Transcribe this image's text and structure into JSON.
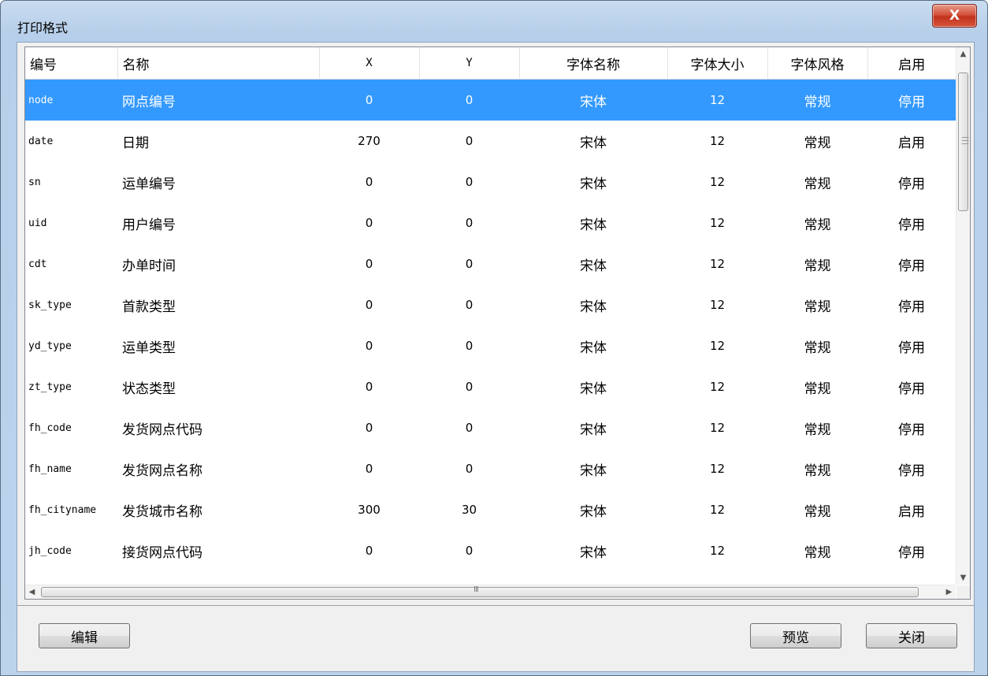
{
  "window": {
    "title": "打印格式",
    "close_label": "X"
  },
  "table": {
    "columns": [
      "编号",
      "名称",
      "X",
      "Y",
      "字体名称",
      "字体大小",
      "字体风格",
      "启用"
    ],
    "rows": [
      {
        "code": "node",
        "name": "网点编号",
        "x": "0",
        "y": "0",
        "font": "宋体",
        "size": "12",
        "style": "常规",
        "enabled": "停用",
        "selected": true
      },
      {
        "code": "date",
        "name": "日期",
        "x": "270",
        "y": "0",
        "font": "宋体",
        "size": "12",
        "style": "常规",
        "enabled": "启用"
      },
      {
        "code": "sn",
        "name": "运单编号",
        "x": "0",
        "y": "0",
        "font": "宋体",
        "size": "12",
        "style": "常规",
        "enabled": "停用"
      },
      {
        "code": "uid",
        "name": "用户编号",
        "x": "0",
        "y": "0",
        "font": "宋体",
        "size": "12",
        "style": "常规",
        "enabled": "停用"
      },
      {
        "code": "cdt",
        "name": "办单时间",
        "x": "0",
        "y": "0",
        "font": "宋体",
        "size": "12",
        "style": "常规",
        "enabled": "停用"
      },
      {
        "code": "sk_type",
        "name": "首款类型",
        "x": "0",
        "y": "0",
        "font": "宋体",
        "size": "12",
        "style": "常规",
        "enabled": "停用"
      },
      {
        "code": "yd_type",
        "name": "运单类型",
        "x": "0",
        "y": "0",
        "font": "宋体",
        "size": "12",
        "style": "常规",
        "enabled": "停用"
      },
      {
        "code": "zt_type",
        "name": "状态类型",
        "x": "0",
        "y": "0",
        "font": "宋体",
        "size": "12",
        "style": "常规",
        "enabled": "停用"
      },
      {
        "code": "fh_code",
        "name": "发货网点代码",
        "x": "0",
        "y": "0",
        "font": "宋体",
        "size": "12",
        "style": "常规",
        "enabled": "停用"
      },
      {
        "code": "fh_name",
        "name": "发货网点名称",
        "x": "0",
        "y": "0",
        "font": "宋体",
        "size": "12",
        "style": "常规",
        "enabled": "停用"
      },
      {
        "code": "fh_cityname",
        "name": "发货城市名称",
        "x": "300",
        "y": "30",
        "font": "宋体",
        "size": "12",
        "style": "常规",
        "enabled": "启用"
      },
      {
        "code": "jh_code",
        "name": "接货网点代码",
        "x": "0",
        "y": "0",
        "font": "宋体",
        "size": "12",
        "style": "常规",
        "enabled": "停用"
      }
    ]
  },
  "buttons": {
    "edit": "编辑",
    "preview": "预览",
    "close": "关闭"
  },
  "scrollbar": {
    "grip": "III"
  }
}
